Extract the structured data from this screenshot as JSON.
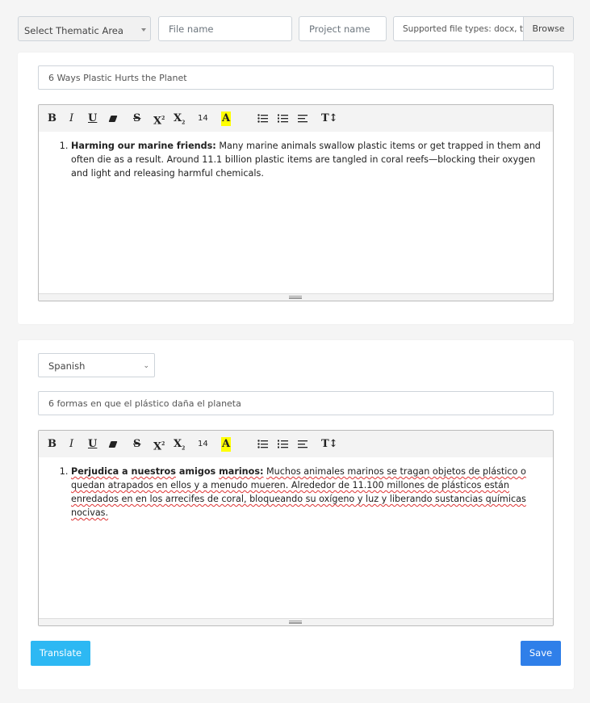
{
  "topbar": {
    "thematic_select": "Select Thematic Area",
    "file_name_placeholder": "File name",
    "project_name_placeholder": "Project name",
    "file_types_text": "Supported file types: docx, txt",
    "browse_label": "Browse"
  },
  "toolbar": {
    "font_size": "14"
  },
  "source": {
    "title": "6 Ways Plastic Hurts the Planet",
    "item_heading": "Harming our marine friends:",
    "item_body": " Many marine animals swallow plastic items or get trapped in them and often die as a result. Around 11.1 billion plastic items are tangled in coral reefs—blocking their oxygen and light and releasing harmful chemicals."
  },
  "translation": {
    "language": "Spanish",
    "title": "6 formas en que el plástico daña el planeta",
    "item_heading_words": [
      "Perjudica",
      "a",
      "nuestros",
      "amigos",
      "marinos:"
    ],
    "item_body": "Muchos animales marinos se tragan objetos de plástico o quedan atrapados en ellos y a menudo mueren. Alrededor de 11.100 millones de plásticos están enredados en en los arrecifes de coral, bloqueando su oxígeno y luz y liberando sustancias químicas nocivas."
  },
  "actions": {
    "translate_label": "Translate",
    "save_label": "Save"
  },
  "colors": {
    "translate_button": "#2db8f3",
    "save_button": "#2f7fe9",
    "highlight": "#ffff00"
  }
}
